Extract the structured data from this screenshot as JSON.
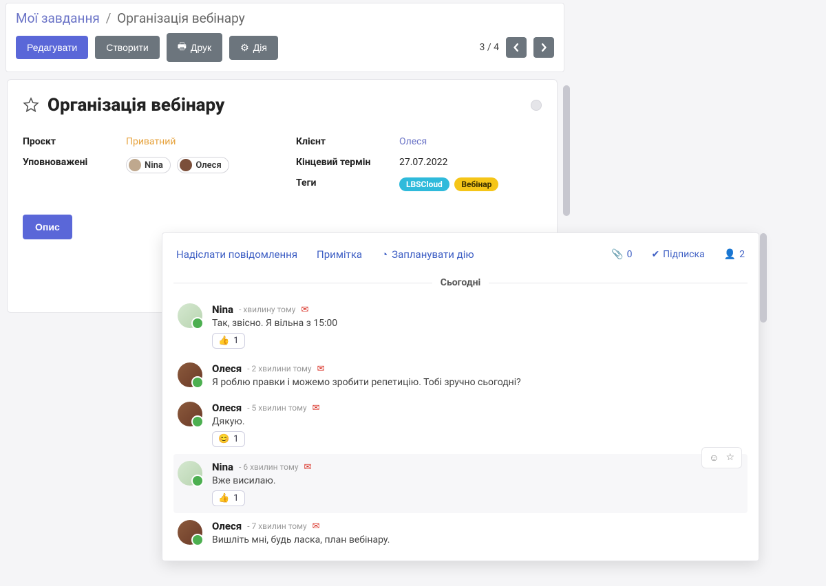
{
  "breadcrumb": {
    "link": "Мої завдання",
    "current": "Організація вебінару"
  },
  "toolbar": {
    "edit": "Редагувати",
    "create": "Створити",
    "print": "Друк",
    "action": "Дія",
    "pager": "3 / 4"
  },
  "task": {
    "title": "Організація вебінару",
    "fields": {
      "project_label": "Проєкт",
      "project_value": "Приватний",
      "assignees_label": "Уповноважені",
      "assignees": [
        {
          "name": "Nina"
        },
        {
          "name": "Олеся"
        }
      ],
      "client_label": "Клієнт",
      "client_value": "Олеся",
      "deadline_label": "Кінцевий термін",
      "deadline_value": "27.07.2022",
      "tags_label": "Теги",
      "tags": [
        {
          "label": "LBSCloud",
          "color": "blue"
        },
        {
          "label": "Вебінар",
          "color": "yellow"
        }
      ]
    },
    "tab_description": "Опис"
  },
  "messaging": {
    "tabs": {
      "send": "Надіслати повідомлення",
      "note": "Примітка",
      "schedule": "Запланувати дію"
    },
    "attachments_count": "0",
    "follow_label": "Підписка",
    "followers_count": "2",
    "date_divider": "Сьогодні",
    "messages": [
      {
        "author": "Nina",
        "avatar": "nina",
        "time": "- хвилину тому",
        "text": "Так, звісно. Я вільна з 15:00",
        "reaction": {
          "emoji": "👍",
          "count": "1"
        }
      },
      {
        "author": "Олеся",
        "avatar": "olesya",
        "time": "- 2 хвилини тому",
        "text": "Я роблю правки і можемо зробити репетицію. Тобі зручно сьогодні?"
      },
      {
        "author": "Олеся",
        "avatar": "olesya",
        "time": "- 5 хвилин тому",
        "text": "Дякую.",
        "reaction": {
          "emoji": "😊",
          "count": "1"
        }
      },
      {
        "author": "Nina",
        "avatar": "nina",
        "time": "- 6 хвилин тому",
        "text": "Вже висилаю.",
        "reaction": {
          "emoji": "👍",
          "count": "1"
        },
        "highlight": true,
        "show_actions": true
      },
      {
        "author": "Олеся",
        "avatar": "olesya",
        "time": "- 7 хвилин тому",
        "text": "Вишліть мні, будь ласка, план вебінару."
      }
    ]
  }
}
